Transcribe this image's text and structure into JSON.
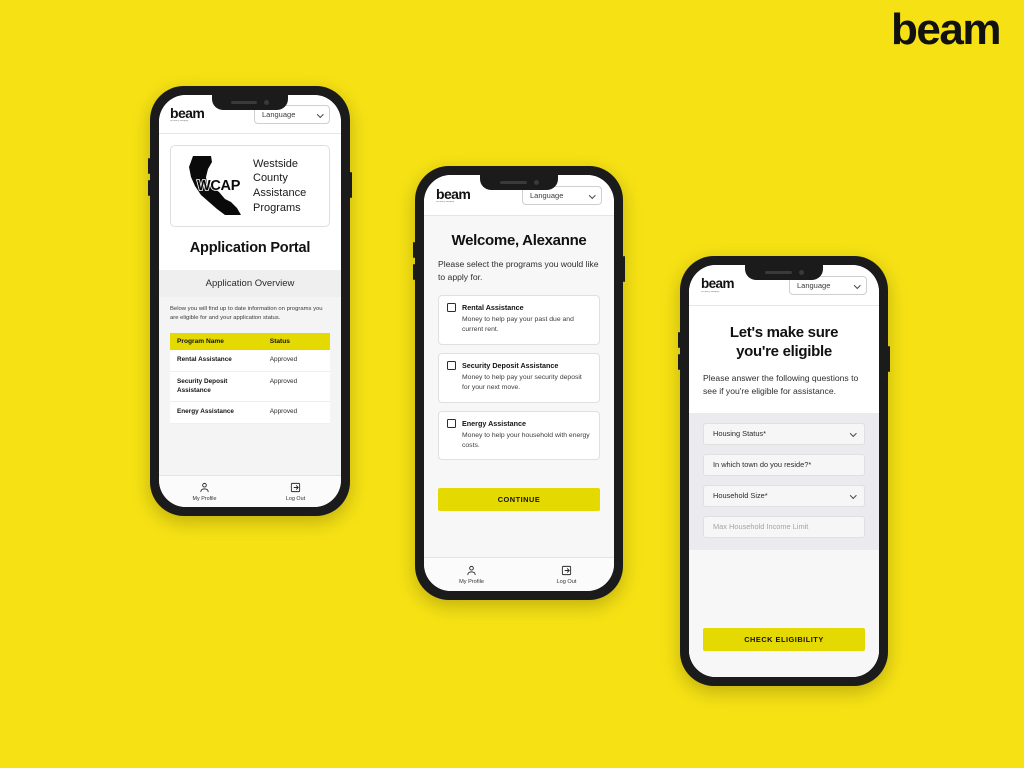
{
  "brand": {
    "wordmark": "beam",
    "sub_wordmark": "formerly edquity",
    "accent_yellow": "#E4D900",
    "background_yellow": "#F5E114",
    "ink": "#111111"
  },
  "shared": {
    "language_label": "Language",
    "chevron_icon": "chevron-down-icon",
    "tabbar": [
      {
        "label": "My Profile",
        "icon": "person-icon"
      },
      {
        "label": "Log Out",
        "icon": "logout-arrow-icon"
      }
    ]
  },
  "phone1": {
    "screen_name": "Application Portal",
    "logo": {
      "word": "beam",
      "sub": "formerly edquity"
    },
    "language_label": "Language",
    "org": {
      "acronym": "WCAP",
      "logo_icon": "california-state-outline-icon",
      "name_lines": [
        "Westside",
        "County",
        "Assistance",
        "Programs"
      ],
      "name_full": "Westside County Assistance Programs"
    },
    "page_title": "Application Portal",
    "section_title": "Application Overview",
    "section_description": "Below you will find up to date information on programs you are eligible for and your application status.",
    "table": {
      "columns": [
        "Program Name",
        "Status"
      ],
      "rows": [
        {
          "program": "Rental Assistance",
          "status": "Approved"
        },
        {
          "program": "Security Deposit Assistance",
          "status": "Approved"
        },
        {
          "program": "Energy Assistance",
          "status": "Approved"
        }
      ]
    }
  },
  "phone2": {
    "screen_name": "Program Selection",
    "logo": {
      "word": "beam",
      "sub": "formerly edquity"
    },
    "language_label": "Language",
    "title": "Welcome, Alexanne",
    "subtitle": "Please select the programs you would like to apply for.",
    "options": [
      {
        "title": "Rental Assistance",
        "description": "Money to help pay your past due and current rent.",
        "checked": false
      },
      {
        "title": "Security Deposit Assistance",
        "description": "Money to help pay your security deposit for your next move.",
        "checked": false
      },
      {
        "title": "Energy Assistance",
        "description": "Money to help your household with energy costs.",
        "checked": false
      }
    ],
    "continue_label": "CONTINUE"
  },
  "phone3": {
    "screen_name": "Eligibility Check",
    "logo": {
      "word": "beam",
      "sub": "formerly edquity"
    },
    "language_label": "Language",
    "title_line1": "Let's make sure",
    "title_line2": "you're eligible",
    "subtitle": "Please answer the following questions to see if you're eligible for assistance.",
    "fields": [
      {
        "label": "Housing Status*",
        "type": "select",
        "is_placeholder": false
      },
      {
        "label": "In which town do you reside?*",
        "type": "select",
        "is_placeholder": false
      },
      {
        "label": "Household Size*",
        "type": "select",
        "is_placeholder": false
      },
      {
        "label": "Max Household Income Limit",
        "type": "text",
        "is_placeholder": true
      }
    ],
    "submit_label": "CHECK ELIGIBILITY"
  }
}
